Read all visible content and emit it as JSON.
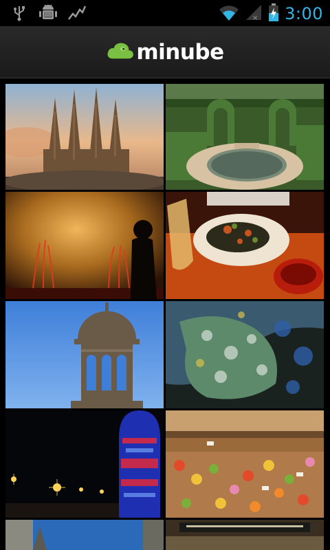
{
  "status_bar": {
    "time": "3:00",
    "icons": [
      "usb-icon",
      "android-debug-icon",
      "activity-graph-icon",
      "wifi-icon",
      "signal-icon",
      "battery-charging-icon"
    ],
    "accent": "#33b5e5"
  },
  "app_bar": {
    "logo_text": "minube",
    "logo_icon": "cloud-icon",
    "brand_color": "#7ac043"
  },
  "photos": [
    {
      "subject": "sagrada-familia"
    },
    {
      "subject": "labyrinth-garden"
    },
    {
      "subject": "magic-fountain"
    },
    {
      "subject": "tapas-plate"
    },
    {
      "subject": "domed-tower"
    },
    {
      "subject": "mosaic-dragon"
    },
    {
      "subject": "agbar-tower-night"
    },
    {
      "subject": "boqueria-market"
    },
    {
      "subject": "gothic-street"
    },
    {
      "subject": "market-stall-sign"
    }
  ]
}
